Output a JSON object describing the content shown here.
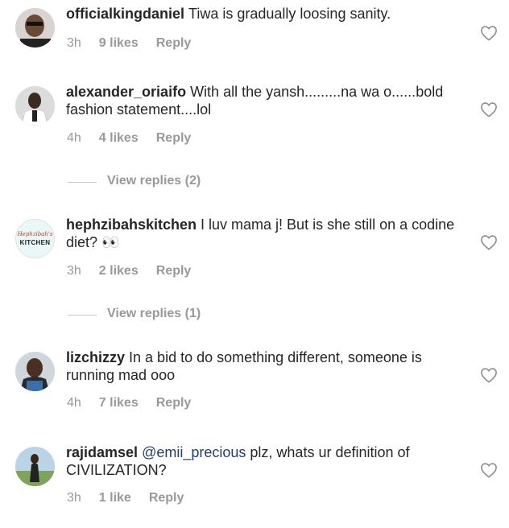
{
  "comments": [
    {
      "username": "officialkingdaniel",
      "text": "Tiwa is gradually loosing sanity.",
      "time": "3h",
      "likes": "9 likes",
      "reply": "Reply"
    },
    {
      "username": "alexander_oriaifo",
      "text": "With all the yansh.........na wa o......bold fashion statement....lol",
      "time": "4h",
      "likes": "4 likes",
      "reply": "Reply"
    },
    {
      "username": "hephzibahskitchen",
      "text": "I luv mama j! But is she still on a codine diet? 👀",
      "time": "3h",
      "likes": "2 likes",
      "reply": "Reply",
      "avatar_text": "KITCHEN",
      "avatar_script": "Hephzibah's"
    },
    {
      "username": "lizchizzy",
      "text": "In a bid to do something different, someone is running mad ooo",
      "time": "4h",
      "likes": "7 likes",
      "reply": "Reply"
    },
    {
      "username": "rajidamsel",
      "mention": "@emii_precious",
      "text": "plz, whats ur definition of CIVILIZATION?",
      "time": "3h",
      "likes": "1 like",
      "reply": "Reply"
    }
  ],
  "view_replies": [
    "View replies (2)",
    "View replies (1)"
  ],
  "colors": {
    "text": "#262626",
    "meta": "#999999",
    "mention": "#1f3f6e",
    "divider": "#c7c7c7"
  }
}
